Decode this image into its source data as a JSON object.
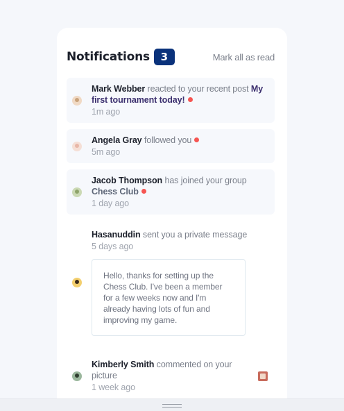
{
  "header": {
    "title": "Notifications",
    "count": "3",
    "mark_all": "Mark all as read"
  },
  "notifications": [
    {
      "user": "Mark Webber",
      "action": " reacted to your recent post ",
      "target": "My first tournament today!",
      "time": "1m ago",
      "unread": true,
      "avatar_color": "#c9a27b"
    },
    {
      "user": "Angela Gray",
      "action": " followed you",
      "target": "",
      "time": "5m ago",
      "unread": true,
      "avatar_color": "#e8b7a8"
    },
    {
      "user": "Jacob Thompson",
      "action": " has joined your group ",
      "target": "Chess Club",
      "time": "1 day ago",
      "unread": true,
      "avatar_color": "#8ea36a"
    },
    {
      "user": "Hasanuddin",
      "action": " sent you a private message",
      "time": "5 days ago",
      "unread": false,
      "avatar_color": "#e0a531",
      "message": "Hello, thanks for setting up the Chess Club. I've been a member for a few weeks now and I'm already having lots of fun and improving my game."
    },
    {
      "user": "Kimberly Smith",
      "action": " commented on your picture",
      "time": "1 week ago",
      "unread": false,
      "avatar_color": "#4b6b4f"
    }
  ],
  "colors": {
    "badge": "#0a327b",
    "unread_dot": "#f65552",
    "unread_bg": "#f6f8fc"
  },
  "icons": {
    "resize_handle": "horizontal-grip-icon"
  }
}
